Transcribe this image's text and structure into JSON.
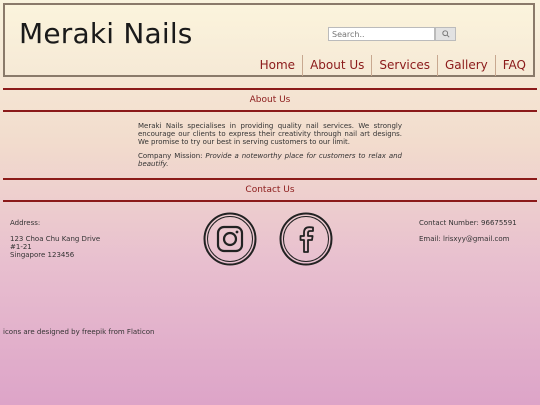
{
  "header": {
    "logo": "Meraki Nails",
    "search_placeholder": "Search..",
    "nav": [
      "Home",
      "About Us",
      "Services",
      "Gallery",
      "FAQ"
    ]
  },
  "about": {
    "title": "About Us",
    "paragraph": "Meraki Nails specialises in providing quality nail services. We strongly encourage our clients to express their creativity through nail art designs. We promise to try our best in serving customers to our limit.",
    "mission_label": "Company Mission: ",
    "mission_text": "Provide a noteworthy place for customers to relax and beautify."
  },
  "contact": {
    "title": "Contact Us",
    "address_label": "Address:",
    "address_lines": [
      "123 Choa Chu Kang Drive",
      "#1-21",
      "Singapore 123456"
    ],
    "number": "Contact Number: 96675591",
    "email": "Email: lrisxyy@gmail.com",
    "social_icons": [
      "instagram-icon",
      "facebook-icon"
    ]
  },
  "credits": "icons are designed by freepik from Flaticon",
  "colors": {
    "accent": "#8b1a1a",
    "header_border": "#8a7a6a"
  }
}
